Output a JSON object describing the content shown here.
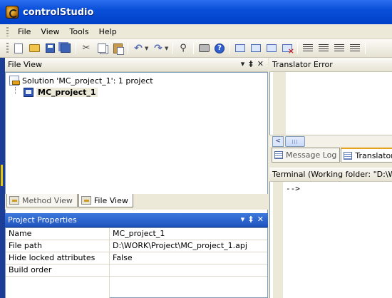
{
  "window": {
    "title": "controlStudio"
  },
  "menu": {
    "items": [
      "File",
      "View",
      "Tools",
      "Help"
    ]
  },
  "toolbar": {
    "icons": [
      "new-file-icon",
      "open-folder-icon",
      "save-icon",
      "save-all-icon",
      "cut-icon",
      "copy-icon",
      "paste-icon",
      "undo-icon",
      "redo-icon",
      "find-icon",
      "print-icon",
      "help-icon",
      "window-icon",
      "window-arrow-icon",
      "window-down-icon",
      "window-close-icon",
      "align-left-icon",
      "align-center-icon",
      "align-right-icon",
      "align-justify-icon"
    ]
  },
  "file_view": {
    "title": "File View",
    "controls": [
      "▾",
      "‡",
      "✕"
    ],
    "solution_label": "Solution 'MC_project_1': 1 project",
    "project_label": "MC_project_1",
    "tabs": [
      {
        "label": "Method View",
        "active": false
      },
      {
        "label": "File View",
        "active": true
      }
    ]
  },
  "project_properties": {
    "title": "Project Properties",
    "controls": [
      "▾",
      "‡",
      "✕"
    ],
    "rows": [
      {
        "key": "Name",
        "value": "MC_project_1"
      },
      {
        "key": "File path",
        "value": "D:\\WORK\\Project\\MC_project_1.apj"
      },
      {
        "key": "Hide locked attributes",
        "value": "False"
      },
      {
        "key": "Build order",
        "value": ""
      }
    ]
  },
  "translator_error": {
    "title": "Translator Error",
    "scroll_left_glyph": "<",
    "tabs": [
      {
        "label": "Message Log",
        "active": false
      },
      {
        "label": "Translator",
        "active": true
      }
    ]
  },
  "terminal": {
    "title": "Terminal (Working folder: \"D:\\WO",
    "prompt": "-->"
  }
}
